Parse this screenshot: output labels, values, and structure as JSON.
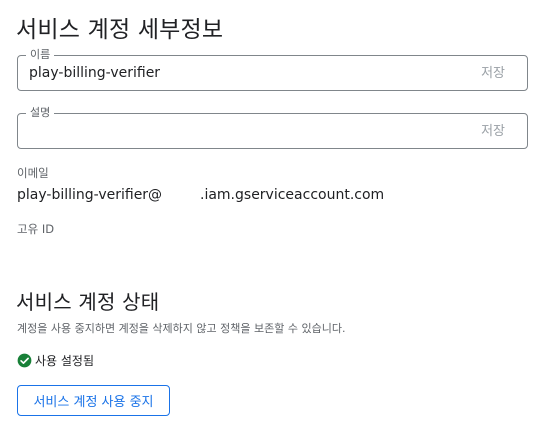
{
  "page": {
    "title": "서비스 계정 세부정보"
  },
  "name_field": {
    "legend": "이름",
    "value": "play-billing-verifier",
    "save_label": "저장"
  },
  "description_field": {
    "legend": "설명",
    "value": "",
    "save_label": "저장"
  },
  "email": {
    "label": "이메일",
    "account_part": "play-billing-verifier@",
    "domain_part": ".iam.gserviceaccount.com"
  },
  "unique_id": {
    "label": "고유 ID"
  },
  "status_section": {
    "title": "서비스 계정 상태",
    "description": "계정을 사용 중지하면 계정을 삭제하지 않고 정책을 보존할 수 있습니다.",
    "status_text": "사용 설정됨",
    "status_icon": "check-circle-icon",
    "status_color": "#188038",
    "disable_button_label": "서비스 계정 사용 중지"
  },
  "colors": {
    "accent": "#1a73e8",
    "success": "#188038"
  }
}
